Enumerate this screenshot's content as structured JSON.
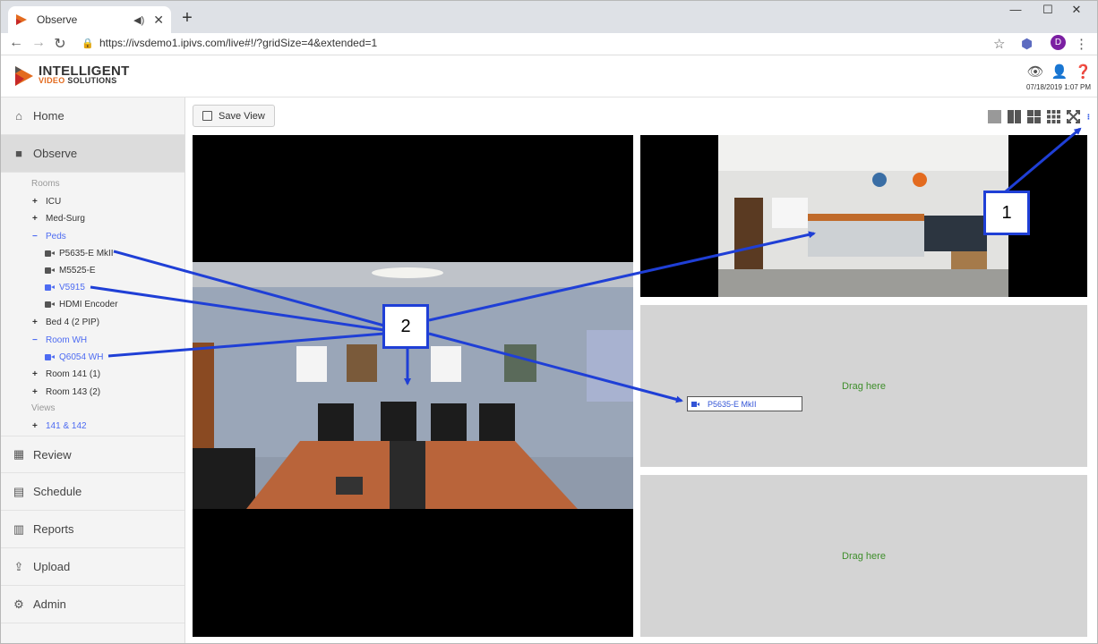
{
  "browser": {
    "tab_title": "Observe",
    "url": "https://ivsdemo1.ipivs.com/live#!/?gridSize=4&extended=1",
    "profile_initial": "D"
  },
  "app": {
    "logo_line1": "INTELLIGENT",
    "logo_line2a": "VIDEO",
    "logo_line2b": "SOLUTIONS",
    "datetime": "07/18/2019 1:07 PM",
    "brand_orange": "#e36b1f"
  },
  "sidebar": {
    "nav_top": [
      {
        "label": "Home",
        "icon": "home-icon"
      },
      {
        "label": "Observe",
        "icon": "video-camera-icon"
      }
    ],
    "rooms_heading": "Rooms",
    "views_heading": "Views",
    "tree": [
      {
        "label": "ICU",
        "type": "room",
        "state": "+"
      },
      {
        "label": "Med-Surg",
        "type": "room",
        "state": "+"
      },
      {
        "label": "Peds",
        "type": "room",
        "state": "−"
      },
      {
        "label": "P5635-E MkII",
        "type": "camera"
      },
      {
        "label": "M5525-E",
        "type": "camera"
      },
      {
        "label": "V5915",
        "type": "camera"
      },
      {
        "label": "HDMI Encoder",
        "type": "camera"
      },
      {
        "label": "Bed 4 (2 PIP)",
        "type": "room",
        "state": "+"
      },
      {
        "label": "Room WH",
        "type": "room",
        "state": "−"
      },
      {
        "label": "Q6054 WH",
        "type": "camera"
      },
      {
        "label": "Room 141 (1)",
        "type": "room",
        "state": "+"
      },
      {
        "label": "Room 143 (2)",
        "type": "room",
        "state": "+"
      }
    ],
    "views": [
      {
        "label": "141 & 142",
        "state": "+"
      }
    ],
    "nav_bottom": [
      {
        "label": "Review",
        "icon": "film-icon"
      },
      {
        "label": "Schedule",
        "icon": "calendar-icon"
      },
      {
        "label": "Reports",
        "icon": "bar-chart-icon"
      },
      {
        "label": "Upload",
        "icon": "upload-icon"
      },
      {
        "label": "Admin",
        "icon": "gear-icon"
      }
    ]
  },
  "main": {
    "save_view_label": "Save View",
    "drag_here_1": "Drag here",
    "drag_here_2": "Drag here",
    "drag_chip_label": "P5635-E MkII"
  },
  "annotations": {
    "callout_1": "1",
    "callout_2": "2",
    "color": "#1f3fd6"
  }
}
